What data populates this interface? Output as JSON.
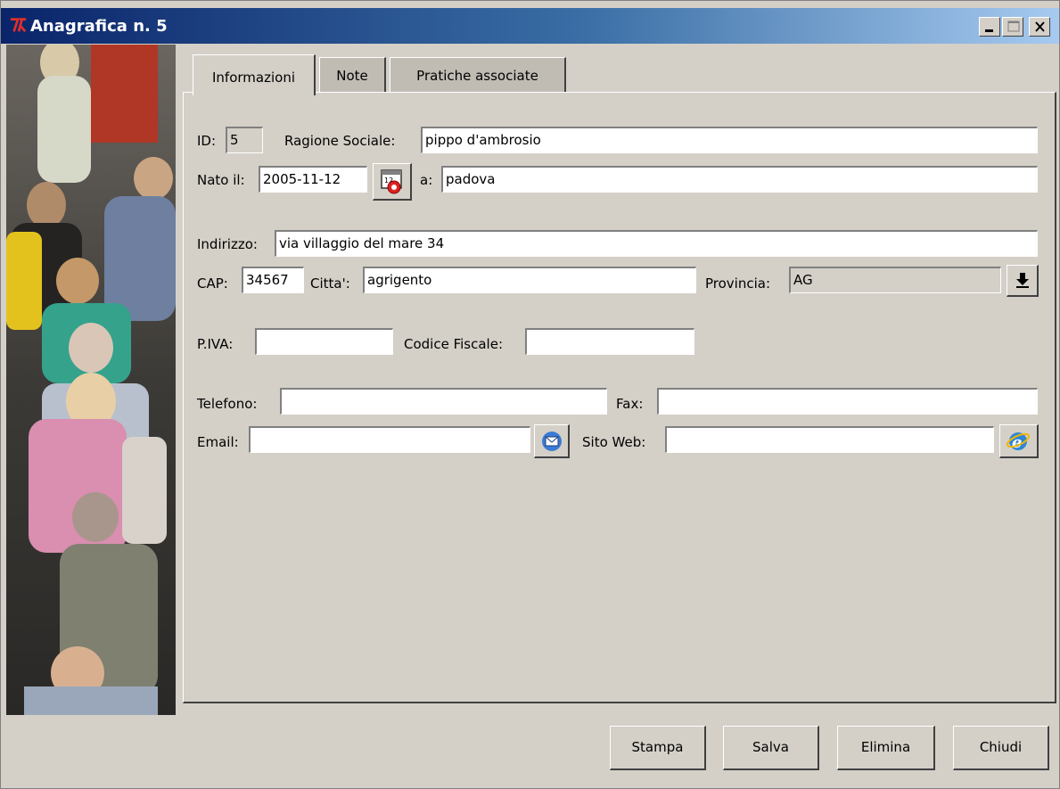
{
  "window": {
    "title": "Anagrafica n. 5"
  },
  "tabs": [
    {
      "label": "Informazioni"
    },
    {
      "label": "Note"
    },
    {
      "label": "Pratiche associate"
    }
  ],
  "form": {
    "id_label": "ID:",
    "id_value": "5",
    "ragione_label": "Ragione Sociale:",
    "ragione_value": "pippo d'ambrosio",
    "nato_label": "Nato il:",
    "nato_value": "2005-11-12",
    "a_label": "a:",
    "a_value": "padova",
    "indirizzo_label": "Indirizzo:",
    "indirizzo_value": "via villaggio del mare 34",
    "cap_label": "CAP:",
    "cap_value": "34567",
    "citta_label": "Citta':",
    "citta_value": "agrigento",
    "provincia_label": "Provincia:",
    "provincia_value": "AG",
    "piva_label": "P.IVA:",
    "piva_value": "",
    "cf_label": "Codice Fiscale:",
    "cf_value": "",
    "telefono_label": "Telefono:",
    "telefono_value": "",
    "fax_label": "Fax:",
    "fax_value": "",
    "email_label": "Email:",
    "email_value": "",
    "sito_label": "Sito Web:",
    "sito_value": ""
  },
  "buttons": {
    "stampa": "Stampa",
    "salva": "Salva",
    "elimina": "Elimina",
    "chiudi": "Chiudi"
  },
  "colors": {
    "face": "#d4d0c8",
    "title_start": "#0a246a",
    "title_end": "#a6caf0"
  },
  "icons": [
    "app-logo-icon",
    "minimize-icon",
    "maximize-icon",
    "close-icon",
    "calendar-icon",
    "dropdown-arrow-icon",
    "send-email-icon",
    "internet-explorer-icon"
  ]
}
